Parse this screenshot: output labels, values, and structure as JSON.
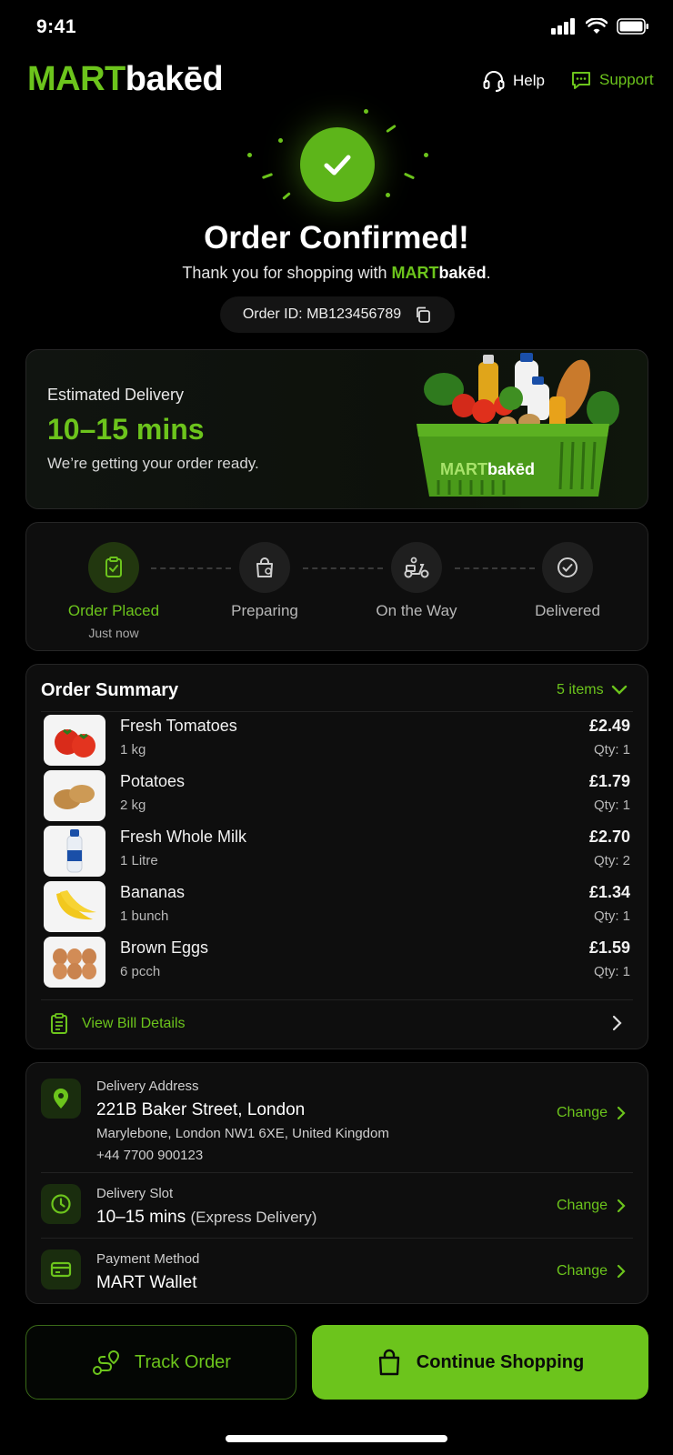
{
  "status_bar": {
    "time": "9:41"
  },
  "header": {
    "logo_part1": "MART",
    "logo_part2": "bakēd",
    "help_label": "Help",
    "support_label": "Support"
  },
  "confirmation": {
    "title": "Order Confirmed!",
    "subtitle_prefix": "Thank you for shopping with ",
    "subtitle_brand1": "MART",
    "subtitle_brand2": "bakēd",
    "subtitle_suffix": ".",
    "order_id": "Order ID: MB123456789"
  },
  "eta": {
    "label": "Estimated Delivery",
    "value": "10–15 mins",
    "note": "We’re getting your order ready.",
    "basket_brand1": "MART",
    "basket_brand2": "bakēd"
  },
  "progress": {
    "steps": [
      {
        "label": "Order Placed",
        "when": "Just now",
        "active": true
      },
      {
        "label": "Preparing"
      },
      {
        "label": "On the Way"
      },
      {
        "label": "Delivered"
      }
    ]
  },
  "summary": {
    "title": "Order Summary",
    "count": "5 items",
    "items": [
      {
        "name": "Fresh Tomatoes",
        "unit": "1 kg",
        "price": "£2.49",
        "qty": "Qty: 1"
      },
      {
        "name": "Potatoes",
        "unit": "2 kg",
        "price": "£1.79",
        "qty": "Qty: 1"
      },
      {
        "name": "Fresh Whole Milk",
        "unit": "1 Litre",
        "price": "£2.70",
        "qty": "Qty: 2"
      },
      {
        "name": "Bananas",
        "unit": "1 bunch",
        "price": "£1.34",
        "qty": "Qty: 1"
      },
      {
        "name": "Brown Eggs",
        "unit": "6 pcch",
        "price": "£1.59",
        "qty": "Qty: 1"
      }
    ],
    "bill_label": "View Bill Details"
  },
  "details": {
    "address_label": "Delivery Address",
    "address_line1": "221B Baker Street, London",
    "address_line2": "Marylebone, London NW1 6XE, United Kingdom",
    "phone": "+44 7700 900123",
    "slot_label": "Delivery Slot",
    "slot_value": "10–15 mins",
    "slot_note": "(Express Delivery)",
    "payment_label": "Payment Method",
    "payment_value": "MART Wallet",
    "change_label": "Change"
  },
  "actions": {
    "track_label": "Track Order",
    "shop_label": "Continue Shopping"
  },
  "colors": {
    "accent": "#6cc41c",
    "background": "#000000",
    "card": "#0e0e0e"
  }
}
